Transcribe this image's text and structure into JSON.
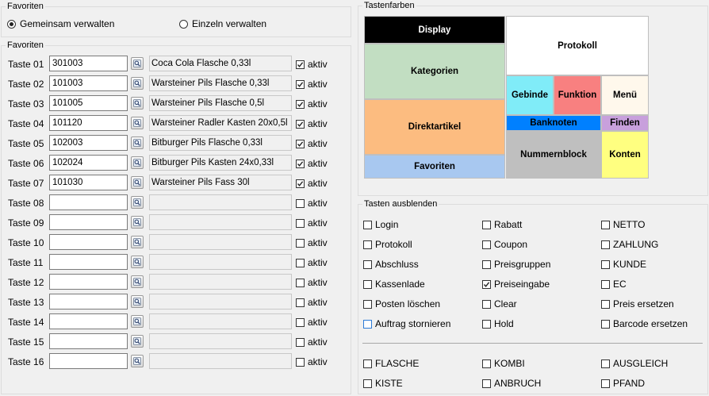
{
  "favoriten_mode": {
    "title": "Favoriten",
    "option_shared": "Gemeinsam verwalten",
    "option_single": "Einzeln verwalten",
    "selected": "shared"
  },
  "favoriten": {
    "title": "Favoriten",
    "active_label": "aktiv",
    "rows": [
      {
        "label": "Taste 01",
        "code": "301003",
        "desc": "Coca Cola Flasche 0,33l",
        "active": true
      },
      {
        "label": "Taste 02",
        "code": "101003",
        "desc": "Warsteiner Pils Flasche 0,33l",
        "active": true
      },
      {
        "label": "Taste 03",
        "code": "101005",
        "desc": "Warsteiner Pils Flasche 0,5l",
        "active": true
      },
      {
        "label": "Taste 04",
        "code": "101120",
        "desc": "Warsteiner Radler Kasten 20x0,5l",
        "active": true
      },
      {
        "label": "Taste 05",
        "code": "102003",
        "desc": "Bitburger Pils Flasche 0,33l",
        "active": true
      },
      {
        "label": "Taste 06",
        "code": "102024",
        "desc": "Bitburger Pils Kasten 24x0,33l",
        "active": true
      },
      {
        "label": "Taste 07",
        "code": "101030",
        "desc": "Warsteiner Pils Fass 30l",
        "active": true
      },
      {
        "label": "Taste 08",
        "code": "",
        "desc": "",
        "active": false
      },
      {
        "label": "Taste 09",
        "code": "",
        "desc": "",
        "active": false
      },
      {
        "label": "Taste 10",
        "code": "",
        "desc": "",
        "active": false
      },
      {
        "label": "Taste 11",
        "code": "",
        "desc": "",
        "active": false
      },
      {
        "label": "Taste 12",
        "code": "",
        "desc": "",
        "active": false
      },
      {
        "label": "Taste 13",
        "code": "",
        "desc": "",
        "active": false
      },
      {
        "label": "Taste 14",
        "code": "",
        "desc": "",
        "active": false
      },
      {
        "label": "Taste 15",
        "code": "",
        "desc": "",
        "active": false
      },
      {
        "label": "Taste 16",
        "code": "",
        "desc": "",
        "active": false
      }
    ]
  },
  "tastenfarben": {
    "title": "Tastenfarben",
    "tiles": {
      "display": {
        "label": "Display",
        "color": "#000000",
        "text_color": "#ffffff"
      },
      "protokoll": {
        "label": "Protokoll",
        "color": "#ffffff",
        "text_color": "#000000"
      },
      "kategorien": {
        "label": "Kategorien",
        "color": "#c2dec2",
        "text_color": "#000000"
      },
      "gebinde": {
        "label": "Gebinde",
        "color": "#80ecf8",
        "text_color": "#000000"
      },
      "funktion": {
        "label": "Funktion",
        "color": "#f88080",
        "text_color": "#000000"
      },
      "menue": {
        "label": "Menü",
        "color": "#fff8ec",
        "text_color": "#000000"
      },
      "direktartikel": {
        "label": "Direktartikel",
        "color": "#fcbc80",
        "text_color": "#000000"
      },
      "banknoten": {
        "label": "Banknoten",
        "color": "#0080ff",
        "text_color": "#000000"
      },
      "finden": {
        "label": "Finden",
        "color": "#c8a0dc",
        "text_color": "#000000"
      },
      "nummernblock": {
        "label": "Nummernblock",
        "color": "#bfbfbf",
        "text_color": "#000000"
      },
      "konten": {
        "label": "Konten",
        "color": "#ffff80",
        "text_color": "#000000"
      },
      "favoriten": {
        "label": "Favoriten",
        "color": "#a8c8f0",
        "text_color": "#000000"
      }
    }
  },
  "tasten_ausblenden": {
    "title": "Tasten ausblenden",
    "columns": [
      [
        {
          "label": "Login",
          "checked": false
        },
        {
          "label": "Protokoll",
          "checked": false
        },
        {
          "label": "Abschluss",
          "checked": false
        },
        {
          "label": "Kassenlade",
          "checked": false
        },
        {
          "label": "Posten löschen",
          "checked": false
        },
        {
          "label": "Auftrag stornieren",
          "checked": false,
          "focused": true
        }
      ],
      [
        {
          "label": "Rabatt",
          "checked": false
        },
        {
          "label": "Coupon",
          "checked": false
        },
        {
          "label": "Preisgruppen",
          "checked": false
        },
        {
          "label": "Preiseingabe",
          "checked": true
        },
        {
          "label": "Clear",
          "checked": false
        },
        {
          "label": "Hold",
          "checked": false
        }
      ],
      [
        {
          "label": "NETTO",
          "checked": false
        },
        {
          "label": "ZAHLUNG",
          "checked": false
        },
        {
          "label": "KUNDE",
          "checked": false
        },
        {
          "label": "EC",
          "checked": false
        },
        {
          "label": "Preis ersetzen",
          "checked": false
        },
        {
          "label": "Barcode ersetzen",
          "checked": false
        }
      ]
    ],
    "extra_columns": [
      [
        {
          "label": "FLASCHE",
          "checked": false
        },
        {
          "label": "KISTE",
          "checked": false
        }
      ],
      [
        {
          "label": "KOMBI",
          "checked": false
        },
        {
          "label": "ANBRUCH",
          "checked": false
        }
      ],
      [
        {
          "label": "AUSGLEICH",
          "checked": false
        },
        {
          "label": "PFAND",
          "checked": false
        }
      ]
    ]
  }
}
